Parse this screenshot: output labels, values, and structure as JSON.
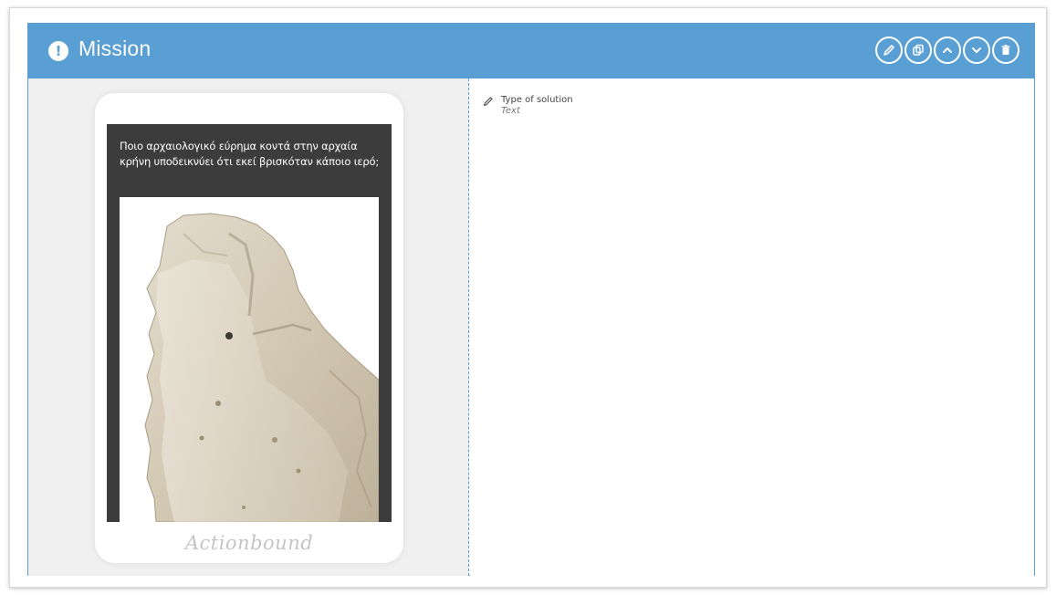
{
  "header": {
    "title": "Mission",
    "icon": "exclamation-circle-icon",
    "actions": [
      {
        "name": "edit",
        "icon": "pencil-icon"
      },
      {
        "name": "duplicate",
        "icon": "copy-icon"
      },
      {
        "name": "move-up",
        "icon": "chevron-up-icon"
      },
      {
        "name": "move-down",
        "icon": "chevron-down-icon"
      },
      {
        "name": "delete",
        "icon": "trash-icon"
      }
    ]
  },
  "preview": {
    "question": "Ποιο αρχαιολογικό εύρημα κοντά στην αρχαία κρήνη υποδεικνύει ότι εκεί βρισκόταν κάποιο ιερό;",
    "image": "stone-artifact-photo",
    "brand": "Actionbound"
  },
  "solution": {
    "label": "Type of solution",
    "value": "Text"
  },
  "colors": {
    "accent": "#5a9fd4",
    "screen": "#3c3c3c",
    "pane_bg": "#f0f0f0"
  }
}
